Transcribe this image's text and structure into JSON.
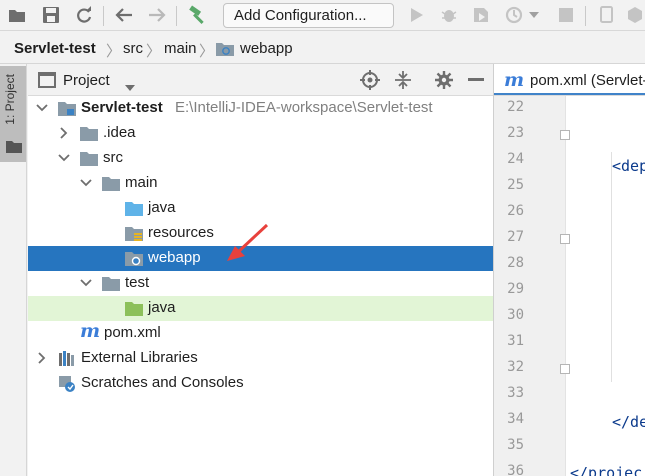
{
  "toolbar": {
    "add_configuration": "Add Configuration...",
    "icons": [
      "open-folder-icon",
      "save-icon",
      "sync-icon",
      "back-icon",
      "forward-icon",
      "build-hammer-icon",
      "run-icon",
      "debug-icon",
      "coverage-icon",
      "profile-icon",
      "dropdown-icon",
      "stop-icon",
      "device-icon",
      "sdk-icon"
    ]
  },
  "breadcrumb": {
    "items": [
      "Servlet-test",
      "src",
      "main",
      "webapp"
    ]
  },
  "left_strip": {
    "label": "1: Project"
  },
  "project_panel": {
    "title": "Project",
    "tree": [
      {
        "label": "Servlet-test",
        "path": "E:\\IntelliJ-IDEA-workspace\\Servlet-test",
        "icon": "module-folder-icon",
        "expanded": true,
        "depth": 0
      },
      {
        "label": ".idea",
        "icon": "folder-icon",
        "expanded": false,
        "depth": 1
      },
      {
        "label": "src",
        "icon": "folder-icon",
        "expanded": true,
        "depth": 1
      },
      {
        "label": "main",
        "icon": "folder-icon",
        "expanded": true,
        "depth": 2
      },
      {
        "label": "java",
        "icon": "source-folder-icon",
        "depth": 3
      },
      {
        "label": "resources",
        "icon": "resources-folder-icon",
        "depth": 3
      },
      {
        "label": "webapp",
        "icon": "web-folder-icon",
        "depth": 3,
        "selected": true
      },
      {
        "label": "test",
        "icon": "folder-icon",
        "expanded": true,
        "depth": 2
      },
      {
        "label": "java",
        "icon": "test-folder-icon",
        "depth": 3
      },
      {
        "label": "pom.xml",
        "icon": "maven-icon",
        "depth": 1
      },
      {
        "label": "External Libraries",
        "icon": "libraries-icon",
        "expanded": false,
        "depth": 0
      },
      {
        "label": "Scratches and Consoles",
        "icon": "scratches-icon",
        "depth": 0
      }
    ]
  },
  "editor": {
    "tab_label": "pom.xml (Servlet-test)",
    "line_numbers": [
      "22",
      "23",
      "24",
      "25",
      "26",
      "27",
      "28",
      "29",
      "30",
      "31",
      "32",
      "33",
      "34",
      "35",
      "36"
    ],
    "code": {
      "line23": "<dep",
      "line34": "</de",
      "line36": "</projec"
    }
  },
  "colors": {
    "selection": "#2675bf",
    "test_row": "#e2f5d6",
    "annotation_arrow": "#e8413c",
    "tab_underline": "#4083c9"
  }
}
